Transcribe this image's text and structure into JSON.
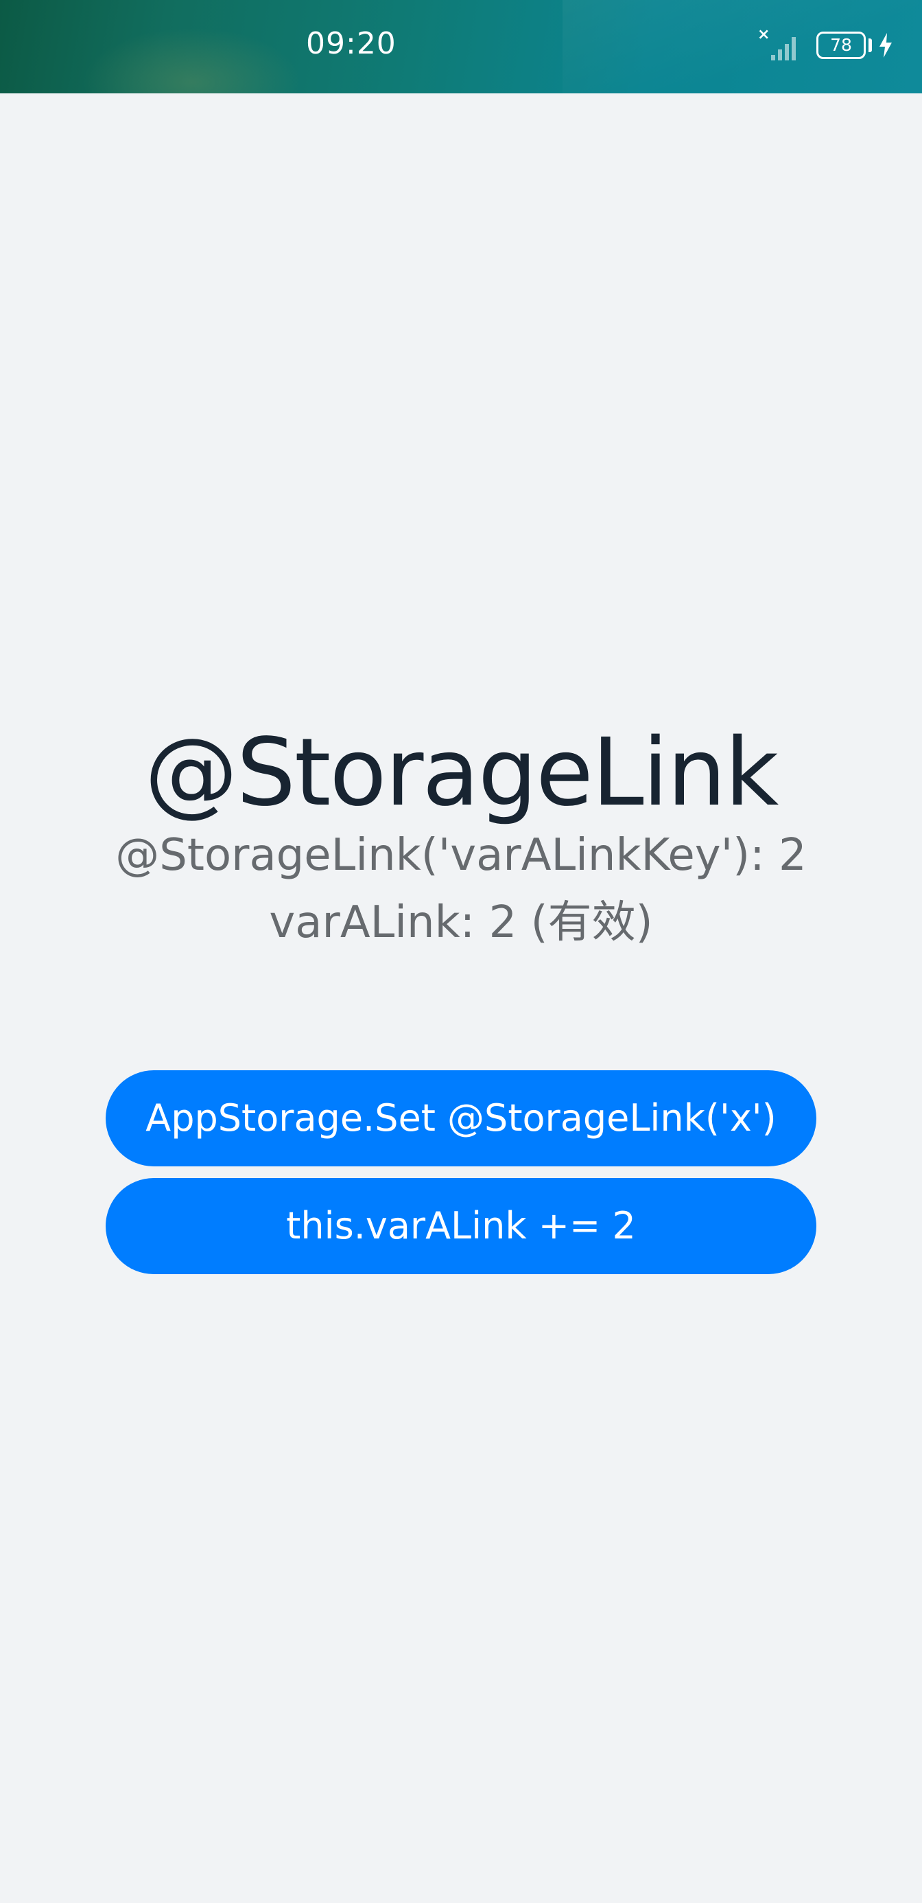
{
  "status_bar": {
    "time": "09:20",
    "battery_level": "78",
    "signal_icon": "signal-bars-icon",
    "no_sim_mark": "×",
    "charging_icon": "lightning-icon"
  },
  "content": {
    "title": "@StorageLink",
    "storage_link_line": "@StorageLink('varALinkKey'): 2",
    "var_a_link_line": "varALink: 2 (有效)"
  },
  "buttons": {
    "set_storage_link": "AppStorage.Set @StorageLink('x')",
    "increment_var_a_link": "this.varALink += 2"
  },
  "colors": {
    "accent": "#007dff",
    "background": "#f1f3f5",
    "title_text": "#182431",
    "secondary_text": "#666a6e"
  }
}
